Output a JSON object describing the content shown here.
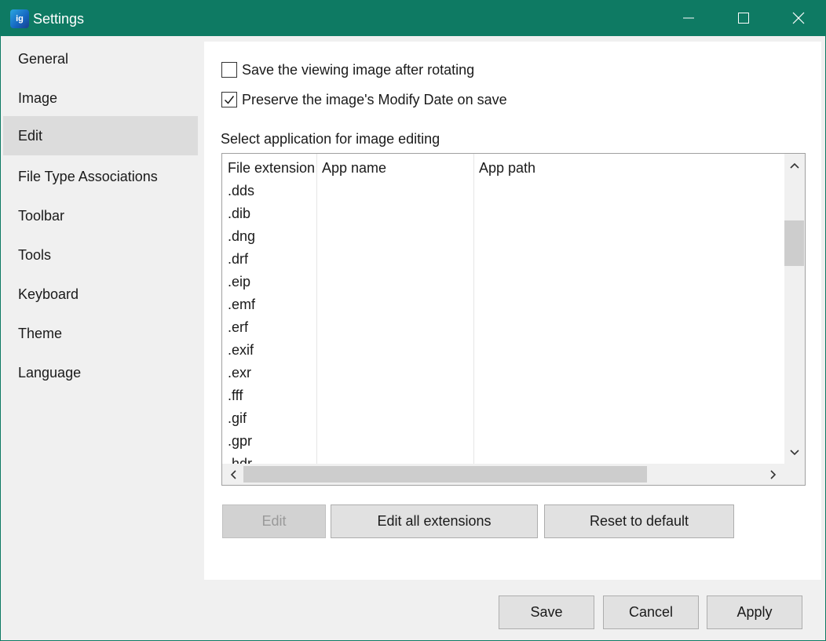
{
  "window": {
    "title": "Settings",
    "app_icon": "ig-app-icon",
    "accent": "#0e7a63"
  },
  "sidebar": {
    "items": [
      {
        "label": "General"
      },
      {
        "label": "Image"
      },
      {
        "label": "Edit",
        "active": true
      },
      {
        "label": "File Type Associations"
      },
      {
        "label": "Toolbar"
      },
      {
        "label": "Tools"
      },
      {
        "label": "Keyboard"
      },
      {
        "label": "Theme"
      },
      {
        "label": "Language"
      }
    ]
  },
  "edit": {
    "save_after_rotate": {
      "label": "Save the viewing image after rotating",
      "checked": false
    },
    "preserve_modify_date": {
      "label": "Preserve the image's Modify Date on save",
      "checked": true
    },
    "select_app_label": "Select application for image editing",
    "table": {
      "headers": [
        "File extension",
        "App name",
        "App path"
      ],
      "rows": [
        ".dds",
        ".dib",
        ".dng",
        ".drf",
        ".eip",
        ".emf",
        ".erf",
        ".exif",
        ".exr",
        ".fff",
        ".gif",
        ".gpr",
        ".hdr"
      ]
    },
    "buttons": {
      "edit": "Edit",
      "edit_all": "Edit all extensions",
      "reset": "Reset to default"
    }
  },
  "footer": {
    "save": "Save",
    "cancel": "Cancel",
    "apply": "Apply"
  }
}
